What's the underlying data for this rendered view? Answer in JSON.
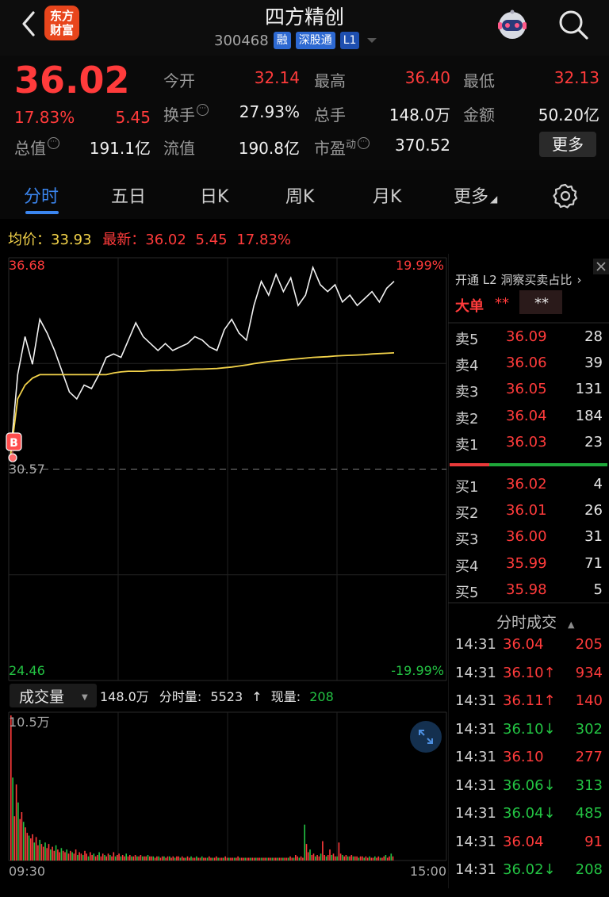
{
  "header": {
    "stock_name": "四方精创",
    "stock_code": "300468",
    "tags": [
      "融",
      "深股通",
      "L1"
    ],
    "logo_line1": "东方",
    "logo_line2": "财富"
  },
  "quote": {
    "price": "36.02",
    "change_pct": "17.83%",
    "change": "5.45",
    "fields": {
      "open_label": "今开",
      "open": "32.14",
      "high_label": "最高",
      "high": "36.40",
      "low_label": "最低",
      "low": "32.13",
      "turnover_label": "换手",
      "turnover": "27.93%",
      "volume_label": "总手",
      "volume": "148.0万",
      "amount_label": "金额",
      "amount": "50.20亿",
      "mktcap_label": "总值",
      "mktcap": "191.1亿",
      "float_label": "流值",
      "float": "190.8亿",
      "pe_label": "市盈",
      "pe_sup": "动",
      "pe": "370.52"
    },
    "more_label": "更多"
  },
  "tabs": [
    "分时",
    "五日",
    "日K",
    "周K",
    "月K",
    "更多"
  ],
  "info_line": {
    "avg_label": "均价：",
    "avg": "33.93",
    "latest_label": "最新：",
    "latest": "36.02",
    "change": "5.45",
    "change_pct": "17.83%"
  },
  "chart_data": {
    "type": "line",
    "price_axis": {
      "max": "36.68",
      "base": "30.57",
      "min": "24.46",
      "max_pct": "19.99%",
      "min_pct": "-19.99%"
    },
    "ylim": [
      24.46,
      36.68
    ],
    "base_price": 30.57,
    "time_labels": [
      "09:30",
      "15:00"
    ],
    "price_series": [
      30.9,
      33.3,
      34.4,
      33.6,
      34.9,
      34.5,
      34.0,
      33.4,
      32.8,
      32.6,
      33.0,
      32.9,
      33.3,
      33.8,
      33.9,
      33.8,
      34.3,
      34.8,
      34.4,
      34.2,
      34.0,
      34.2,
      34.0,
      34.1,
      34.2,
      34.4,
      34.3,
      34.1,
      34.0,
      34.6,
      34.9,
      34.5,
      34.3,
      35.3,
      36.0,
      35.6,
      36.2,
      35.7,
      36.1,
      35.3,
      35.6,
      36.4,
      35.9,
      35.7,
      35.9,
      35.4,
      35.6,
      35.3,
      35.5,
      35.7,
      35.4,
      35.8,
      36.0
    ],
    "avg_series": [
      30.9,
      32.6,
      33.0,
      33.2,
      33.3,
      33.3,
      33.3,
      33.3,
      33.3,
      33.3,
      33.3,
      33.3,
      33.3,
      33.3,
      33.35,
      33.38,
      33.4,
      33.4,
      33.4,
      33.42,
      33.42,
      33.43,
      33.43,
      33.44,
      33.45,
      33.46,
      33.46,
      33.47,
      33.48,
      33.5,
      33.52,
      33.55,
      33.58,
      33.62,
      33.65,
      33.68,
      33.7,
      33.72,
      33.74,
      33.76,
      33.78,
      33.8,
      33.81,
      33.82,
      33.84,
      33.85,
      33.86,
      33.87,
      33.88,
      33.9,
      33.91,
      33.92,
      33.93
    ],
    "volume_label": "成交量",
    "volume_max_label": "10.5万",
    "volume_summary": {
      "total": "148.0万",
      "period_label": "分时量:",
      "period": "5523",
      "now_label": "现量:",
      "now": "208"
    },
    "volume_series": [
      10.5,
      6.0,
      3.2,
      5.5,
      4.2,
      3.0,
      3.5,
      2.8,
      2.4,
      2.0,
      1.8,
      1.6,
      1.9,
      1.3,
      1.7,
      1.1,
      1.5,
      1.2,
      1.0,
      1.3,
      0.9,
      1.2,
      0.8,
      1.0,
      0.7,
      1.1,
      0.8,
      0.6,
      0.9,
      0.7,
      0.6,
      0.8,
      0.5,
      0.7,
      0.6,
      0.5,
      0.8,
      0.4,
      0.6,
      0.5,
      0.4,
      0.7,
      0.5,
      0.3,
      0.6,
      0.4,
      0.5,
      0.3,
      0.4,
      0.6,
      0.3,
      0.5,
      0.4,
      0.3,
      0.5,
      0.4,
      0.3,
      0.6,
      0.3,
      0.4,
      0.5,
      0.3,
      0.4,
      0.3,
      0.5,
      0.3,
      0.4,
      0.3,
      0.3,
      0.4,
      0.3,
      0.3,
      0.4,
      0.3,
      0.3,
      0.3,
      0.4,
      0.3,
      0.3,
      0.3,
      0.2,
      0.3,
      0.3,
      0.2,
      0.3,
      0.3,
      0.2,
      0.3,
      0.3,
      0.2,
      0.3,
      0.2,
      0.3,
      0.3,
      0.2,
      0.3,
      0.2,
      0.2,
      0.3,
      0.2,
      0.3,
      0.2,
      0.2,
      0.3,
      0.2,
      0.2,
      0.3,
      0.2,
      0.2,
      0.2,
      0.3,
      0.2,
      0.2,
      0.2,
      0.3,
      0.2,
      0.2,
      0.2,
      0.2,
      0.3,
      0.2,
      0.2,
      0.2,
      0.2,
      0.2,
      0.2,
      0.3,
      0.2,
      0.2,
      0.2,
      0.2,
      0.2,
      0.2,
      0.2,
      0.2,
      0.2,
      0.2,
      0.2,
      0.2,
      0.2,
      0.2,
      0.2,
      0.2,
      0.2,
      0.2,
      0.2,
      0.2,
      0.2,
      0.2,
      0.2,
      0.2,
      0.2,
      0.2,
      0.2,
      0.2,
      0.3,
      0.2,
      0.2,
      0.4,
      0.3,
      0.2,
      0.3,
      0.2,
      2.6,
      1.2,
      0.6,
      0.8,
      0.4,
      0.5,
      0.3,
      0.4,
      0.3,
      0.5,
      1.4,
      0.4,
      0.3,
      0.4,
      0.8,
      0.4,
      0.5,
      0.3,
      0.3,
      1.3,
      0.5,
      0.4,
      0.3,
      0.4,
      0.3,
      0.3,
      0.4,
      0.3,
      0.3,
      0.3,
      0.2,
      0.3,
      0.3,
      0.2,
      0.3,
      0.2,
      0.3,
      0.2,
      0.2,
      0.3,
      0.2,
      0.3,
      0.2,
      0.2,
      0.3,
      0.4,
      0.2,
      0.3,
      0.5,
      0.3
    ],
    "marker_label": "B"
  },
  "order_book": {
    "promo": "开通 L2 洞察买卖占比",
    "big_label": "大单",
    "big_red": "**",
    "big_green": "**",
    "asks": [
      {
        "label": "卖5",
        "price": "36.09",
        "vol": "28"
      },
      {
        "label": "卖4",
        "price": "36.06",
        "vol": "39"
      },
      {
        "label": "卖3",
        "price": "36.05",
        "vol": "131"
      },
      {
        "label": "卖2",
        "price": "36.04",
        "vol": "184"
      },
      {
        "label": "卖1",
        "price": "36.03",
        "vol": "23"
      }
    ],
    "bids": [
      {
        "label": "买1",
        "price": "36.02",
        "vol": "4"
      },
      {
        "label": "买2",
        "price": "36.01",
        "vol": "26"
      },
      {
        "label": "买3",
        "price": "36.00",
        "vol": "31"
      },
      {
        "label": "买4",
        "price": "35.99",
        "vol": "71"
      },
      {
        "label": "买5",
        "price": "35.98",
        "vol": "5"
      }
    ],
    "buy_ratio": 0.25
  },
  "trades": {
    "title": "分时成交",
    "rows": [
      {
        "time": "14:31",
        "price": "36.04",
        "vol": "205",
        "dir": "",
        "color": "red"
      },
      {
        "time": "14:31",
        "price": "36.10↑",
        "vol": "934",
        "dir": "up",
        "color": "red"
      },
      {
        "time": "14:31",
        "price": "36.11↑",
        "vol": "140",
        "dir": "up",
        "color": "red"
      },
      {
        "time": "14:31",
        "price": "36.10↓",
        "vol": "302",
        "dir": "down",
        "color": "green"
      },
      {
        "time": "14:31",
        "price": "36.10",
        "vol": "277",
        "dir": "",
        "color": "red"
      },
      {
        "time": "14:31",
        "price": "36.06↓",
        "vol": "313",
        "dir": "down",
        "color": "green"
      },
      {
        "time": "14:31",
        "price": "36.04↓",
        "vol": "485",
        "dir": "down",
        "color": "green"
      },
      {
        "time": "14:31",
        "price": "36.04",
        "vol": "91",
        "dir": "",
        "color": "red"
      },
      {
        "time": "14:31",
        "price": "36.02↓",
        "vol": "208",
        "dir": "down",
        "color": "green"
      }
    ]
  }
}
